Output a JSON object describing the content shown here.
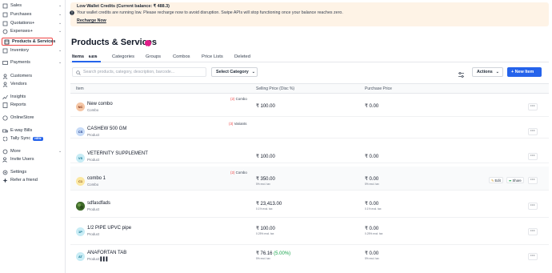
{
  "sidebar": {
    "items": [
      {
        "label": "Sales",
        "chevron": "v"
      },
      {
        "label": "Purchases",
        "chevron": "v"
      },
      {
        "label": "Quotations+",
        "chevron": "v"
      },
      {
        "label": "Expenses+",
        "chevron": "v"
      },
      {
        "label": "Products & Services",
        "active": true
      },
      {
        "label": "Inventory",
        "chevron": "v"
      },
      {
        "label": "Payments",
        "chevron": "v"
      },
      {
        "label": "Customers"
      },
      {
        "label": "Vendors"
      },
      {
        "label": "Insights"
      },
      {
        "label": "Reports"
      },
      {
        "label": "OnlineStore"
      },
      {
        "label": "E-way Bills"
      },
      {
        "label": "Tally Sync",
        "badge": "NEW"
      },
      {
        "label": "More",
        "chevron": "v"
      },
      {
        "label": "Invite Users"
      },
      {
        "label": "Settings"
      },
      {
        "label": "Refer a friend"
      }
    ]
  },
  "alert": {
    "title": "Low Wallet Credits (Current balance: ₹ 488.3)",
    "message": "Your wallet credits are running low. Please recharge now to avoid disruption. Swipe APIs will stop functioning once your balance reaches zero.",
    "link": "Recharge Now"
  },
  "page": {
    "title": "Products & Services"
  },
  "tabs": [
    {
      "label": "Items",
      "count": "6405"
    },
    {
      "label": "Categories"
    },
    {
      "label": "Groups"
    },
    {
      "label": "Combos"
    },
    {
      "label": "Price Lists"
    },
    {
      "label": "Deleted"
    }
  ],
  "toolbar": {
    "search_placeholder": "Search products, category, description, barcode...",
    "select_category": "Select Category",
    "actions": "Actions",
    "new_item": "+ New Item"
  },
  "table": {
    "columns": {
      "item": "Item",
      "selling": "Selling Price (Disc %)",
      "purchase": "Purchase Price"
    },
    "rows": [
      {
        "initials": "NC",
        "name": "New combo",
        "type": "Combo",
        "tag": "Combo",
        "tag_count": "(2)",
        "selling": "₹ 100.00",
        "selling_note": "",
        "purchase": "₹ 0.00",
        "purchase_note": ""
      },
      {
        "initials": "CS",
        "name": "CASHEW 500 GM",
        "type": "Product",
        "tag": "Variants",
        "tag_count": "(3)",
        "selling": "",
        "selling_note": "",
        "purchase": "",
        "purchase_note": ""
      },
      {
        "initials": "VS",
        "name": "VETERNITY SUPPLEMENT",
        "type": "Product",
        "tag": "",
        "tag_count": "",
        "selling": "₹ 100.00",
        "selling_note": "",
        "purchase": "₹ 0.00",
        "purchase_note": ""
      },
      {
        "initials": "C1",
        "name": "combo 1",
        "type": "Combo",
        "tag": "Combo",
        "tag_count": "(2)",
        "selling": "₹ 350.00",
        "selling_note": "5% excl. tax",
        "purchase": "₹ 0.00",
        "purchase_note": "5% excl. tax",
        "edit": "Edit",
        "share": "Share"
      },
      {
        "initials": "",
        "name": "sdfasdfads",
        "type": "Product",
        "tag": "",
        "tag_count": "",
        "selling": "₹ 23,413.00",
        "selling_note": "0.1% excl. tax",
        "purchase": "₹ 0.00",
        "purchase_note": "0.1% excl. tax"
      },
      {
        "initials": "1P",
        "name": "1/2 PIPE UPVC pipe",
        "type": "Product",
        "tag": "",
        "tag_count": "",
        "selling": "₹ 100.00",
        "selling_note": "0.25% excl. tax",
        "purchase": "₹ 0.00",
        "purchase_note": "0.25% excl. tax"
      },
      {
        "initials": "AT",
        "name": "ANAFORTAN TAB",
        "type": "Product",
        "tag": "",
        "tag_count": "",
        "selling": "₹ 76.16",
        "discount": "(5.00%)",
        "selling_note": "5% excl. tax",
        "purchase": "₹ 0.00",
        "purchase_note": "5% excl. tax"
      }
    ]
  },
  "colors": {
    "accent": "#2563eb",
    "alert_bg": "#fef3e6",
    "tag_red": "#ef4444"
  }
}
